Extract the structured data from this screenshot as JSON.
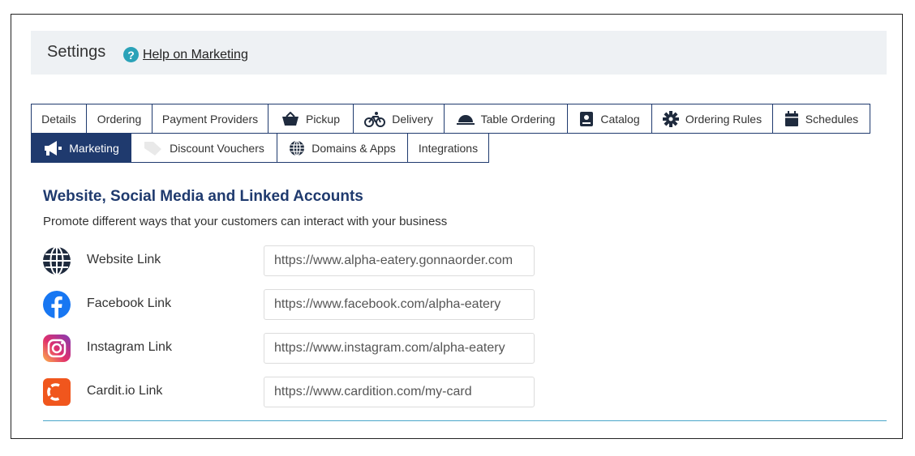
{
  "header": {
    "title": "Settings",
    "help_link": "Help on Marketing"
  },
  "tabs_row1": [
    {
      "label": "Details",
      "icon": ""
    },
    {
      "label": "Ordering",
      "icon": ""
    },
    {
      "label": "Payment Providers",
      "icon": ""
    },
    {
      "label": "Pickup",
      "icon": "basket-icon"
    },
    {
      "label": "Delivery",
      "icon": "bicycle-icon"
    },
    {
      "label": "Table Ordering",
      "icon": "cloche-icon"
    },
    {
      "label": "Catalog",
      "icon": "book-icon"
    },
    {
      "label": "Ordering Rules",
      "icon": "gear-icon"
    },
    {
      "label": "Schedules",
      "icon": "calendar-icon"
    }
  ],
  "tabs_row2": [
    {
      "label": "Marketing",
      "icon": "megaphone-icon",
      "active": true
    },
    {
      "label": "Discount Vouchers",
      "icon": "tag-icon"
    },
    {
      "label": "Domains & Apps",
      "icon": "globe-icon"
    },
    {
      "label": "Integrations",
      "icon": ""
    }
  ],
  "section": {
    "title": "Website, Social Media and Linked Accounts",
    "subtitle": "Promote different ways that your customers can interact with your business"
  },
  "links": [
    {
      "label": "Website Link",
      "value": "https://www.alpha-eatery.gonnaorder.com",
      "icon": "globe-icon"
    },
    {
      "label": "Facebook Link",
      "value": "https://www.facebook.com/alpha-eatery",
      "icon": "facebook-icon"
    },
    {
      "label": "Instagram Link",
      "value": "https://www.instagram.com/alpha-eatery",
      "icon": "instagram-icon"
    },
    {
      "label": "Cardit.io Link",
      "value": "https://www.cardition.com/my-card",
      "icon": "cardit-icon"
    }
  ],
  "colors": {
    "accent": "#1f3a6e",
    "help": "#2aa2b8",
    "divider": "#4aa6c9",
    "facebook": "#1877f2",
    "cardit": "#f0561d"
  }
}
